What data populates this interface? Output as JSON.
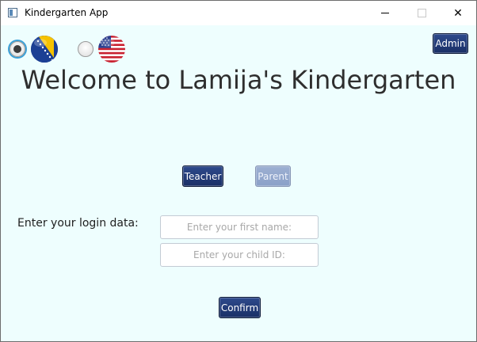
{
  "window": {
    "title": "Kindergarten App",
    "controls": {
      "minimize": "minimize-icon",
      "maximize": "maximize-icon",
      "close": "✕"
    }
  },
  "language": {
    "options": [
      {
        "flag": "bosnia-flag-icon",
        "selected": true
      },
      {
        "flag": "usa-flag-icon",
        "selected": false
      }
    ]
  },
  "header": {
    "admin_label": "Admin",
    "welcome": "Welcome to Lamija's Kindergarten"
  },
  "roles": {
    "teacher_label": "Teacher",
    "parent_label": "Parent"
  },
  "login": {
    "label": "Enter your login data:",
    "first_name_placeholder": "Enter your first name:",
    "child_id_placeholder": "Enter your child ID:",
    "confirm_label": "Confirm"
  },
  "colors": {
    "background": "#eefefe",
    "button": "#1f3670",
    "button_disabled": "#93a8cf",
    "focus_ring": "#3aa0d8"
  }
}
